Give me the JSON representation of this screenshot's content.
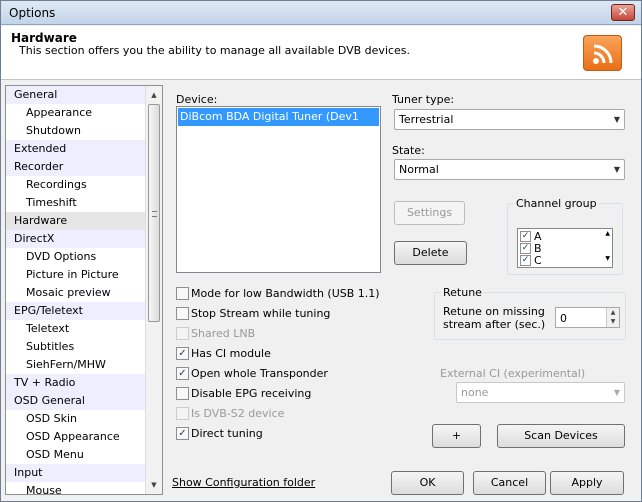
{
  "window": {
    "title": "Options",
    "close_glyph": "✕"
  },
  "header": {
    "title": "Hardware",
    "subtitle": "This section offers you the ability to manage all available DVB devices.",
    "icon": "rss-icon"
  },
  "nav": {
    "items": [
      {
        "label": "General",
        "level": "top"
      },
      {
        "label": "Appearance",
        "level": "sub"
      },
      {
        "label": "Shutdown",
        "level": "sub"
      },
      {
        "label": "Extended",
        "level": "top"
      },
      {
        "label": "Recorder",
        "level": "top"
      },
      {
        "label": "Recordings",
        "level": "sub"
      },
      {
        "label": "Timeshift",
        "level": "sub"
      },
      {
        "label": "Hardware",
        "level": "top",
        "selected": true
      },
      {
        "label": "DirectX",
        "level": "top"
      },
      {
        "label": "DVD Options",
        "level": "sub"
      },
      {
        "label": "Picture in Picture",
        "level": "sub"
      },
      {
        "label": "Mosaic preview",
        "level": "sub"
      },
      {
        "label": "EPG/Teletext",
        "level": "top"
      },
      {
        "label": "Teletext",
        "level": "sub"
      },
      {
        "label": "Subtitles",
        "level": "sub"
      },
      {
        "label": "SiehFern/MHW",
        "level": "sub"
      },
      {
        "label": "TV + Radio",
        "level": "top"
      },
      {
        "label": "OSD General",
        "level": "top"
      },
      {
        "label": "OSD Skin",
        "level": "sub"
      },
      {
        "label": "OSD Appearance",
        "level": "sub"
      },
      {
        "label": "OSD Menu",
        "level": "sub"
      },
      {
        "label": "Input",
        "level": "top"
      },
      {
        "label": "Mouse",
        "level": "sub"
      }
    ]
  },
  "device": {
    "label": "Device:",
    "items": [
      "DiBcom BDA Digital Tuner (Dev1 Path0)"
    ],
    "selected_index": 0
  },
  "tuner": {
    "label": "Tuner type:",
    "value": "Terrestrial"
  },
  "state": {
    "label": "State:",
    "value": "Normal"
  },
  "buttons": {
    "settings": "Settings",
    "delete": "Delete",
    "plus": "+",
    "scan_devices": "Scan Devices",
    "ok": "OK",
    "cancel": "Cancel",
    "apply": "Apply"
  },
  "channel_group": {
    "label": "Channel group",
    "items": [
      {
        "label": "A",
        "checked": true
      },
      {
        "label": "B",
        "checked": true
      },
      {
        "label": "C",
        "checked": true
      }
    ]
  },
  "options": [
    {
      "label": "Mode for low Bandwidth (USB 1.1)",
      "checked": false,
      "enabled": true
    },
    {
      "label": "Stop Stream while tuning",
      "checked": false,
      "enabled": true
    },
    {
      "label": "Shared LNB",
      "checked": false,
      "enabled": false
    },
    {
      "label": "Has CI module",
      "checked": true,
      "enabled": true
    },
    {
      "label": "Open whole Transponder",
      "checked": true,
      "enabled": true
    },
    {
      "label": "Disable EPG receiving",
      "checked": false,
      "enabled": true
    },
    {
      "label": "Is DVB-S2 device",
      "checked": false,
      "enabled": false
    },
    {
      "label": "Direct tuning",
      "checked": true,
      "enabled": true
    }
  ],
  "retune": {
    "label": "Retune",
    "desc_line1": "Retune on missing",
    "desc_line2": "stream after (sec.)",
    "value": "0"
  },
  "external_ci": {
    "label": "External CI (experimental)",
    "value": "none"
  },
  "link": "Show Configuration folder",
  "icons": {
    "check": "✓",
    "arrow_down": "▼",
    "arrow_up": "▲"
  }
}
